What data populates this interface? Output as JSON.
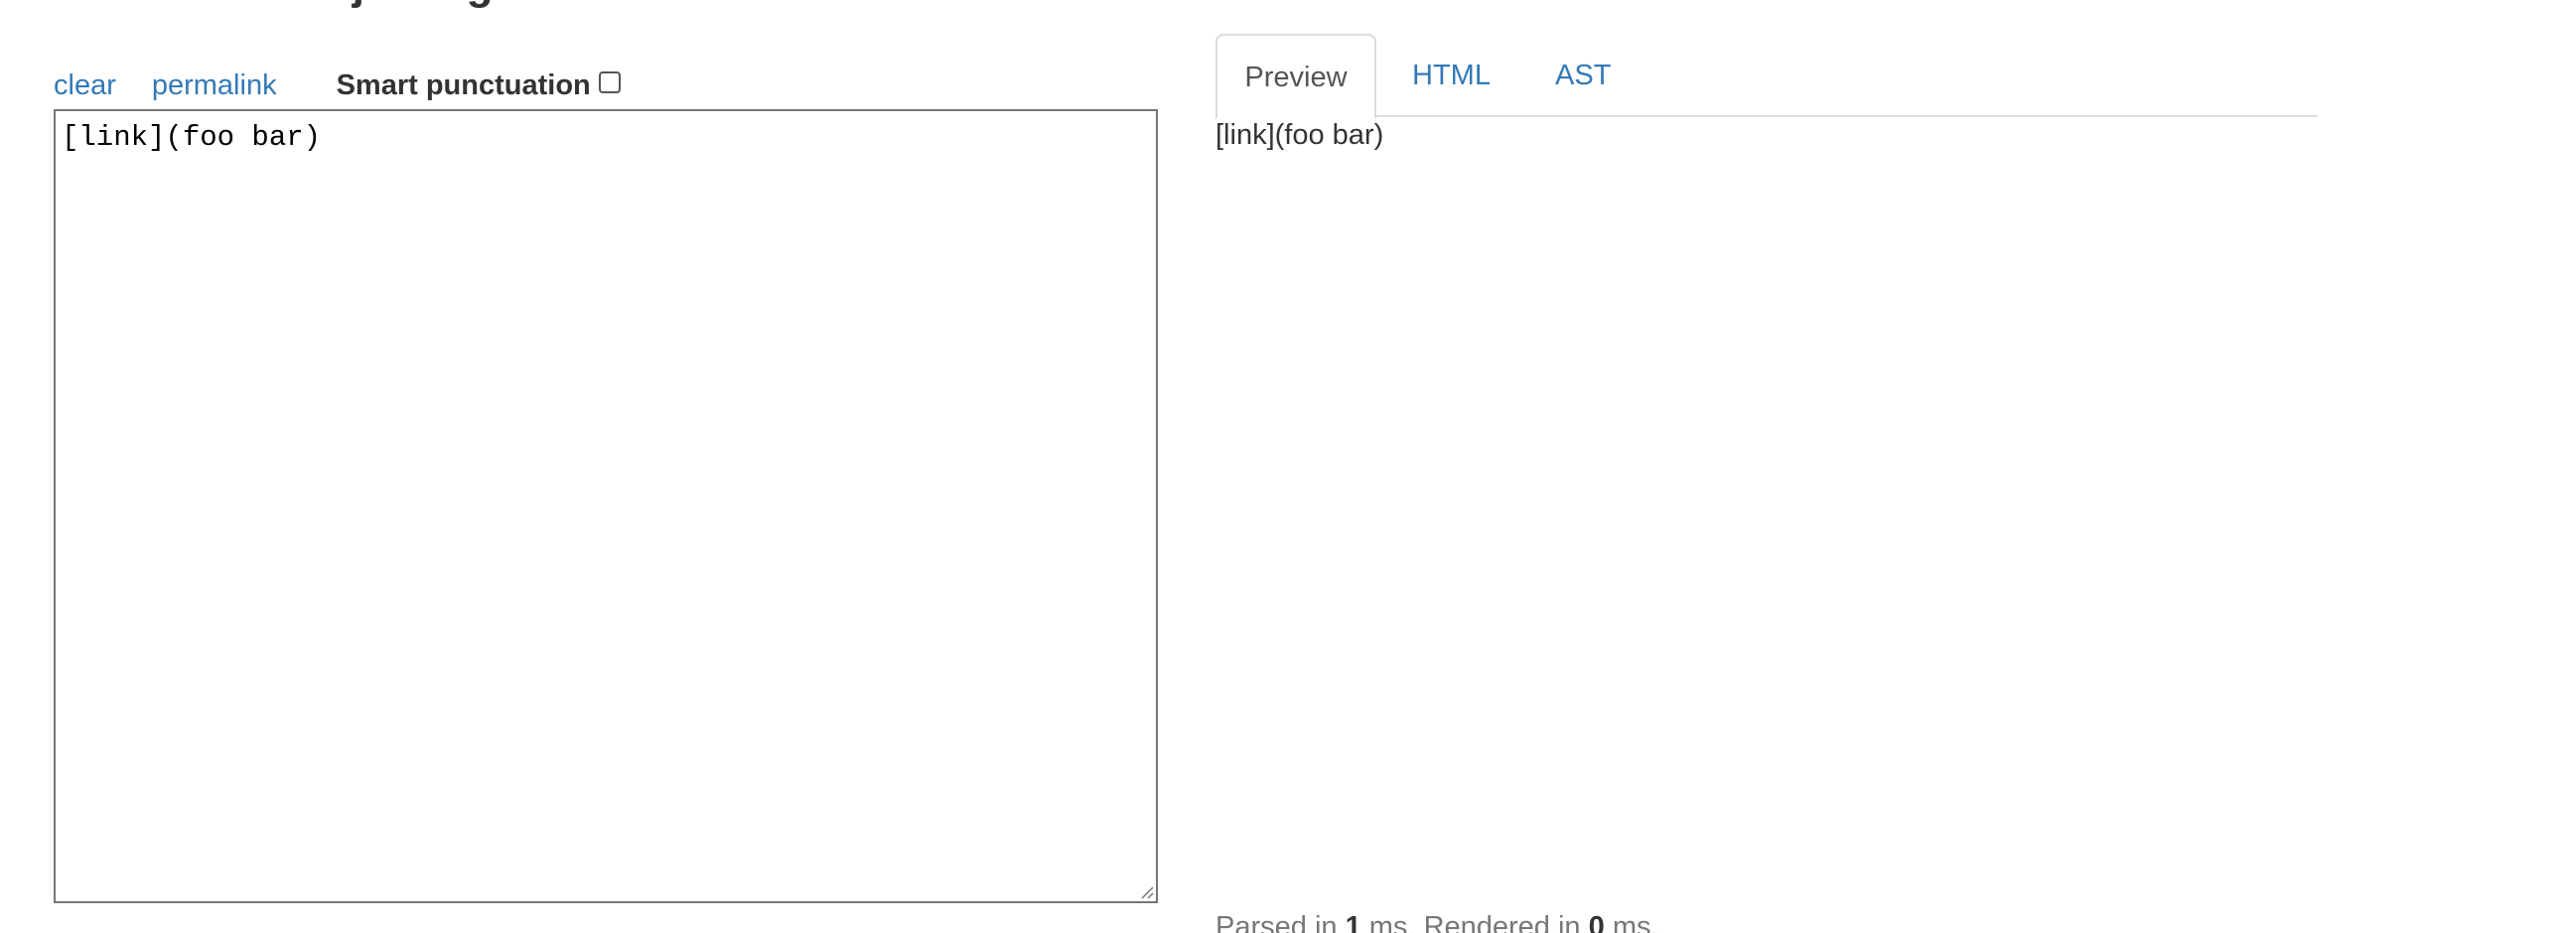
{
  "header": {
    "title": "commonmark.js dingus"
  },
  "toolbar": {
    "clear_label": "clear",
    "permalink_label": "permalink",
    "smart_punctuation_label": "Smart punctuation",
    "smart_punctuation_checked": false
  },
  "editor": {
    "value": "[link](foo bar)"
  },
  "tabs": [
    {
      "label": "Preview",
      "active": true
    },
    {
      "label": "HTML",
      "active": false
    },
    {
      "label": "AST",
      "active": false
    }
  ],
  "preview": {
    "text": "[link](foo bar)"
  },
  "timing": {
    "parsed_prefix": "Parsed in ",
    "parsed_ms": "1",
    "parsed_suffix": " ms. ",
    "rendered_prefix": "Rendered in ",
    "rendered_ms": "0",
    "rendered_suffix": " ms."
  },
  "colors": {
    "link": "#337ab7",
    "text": "#333333",
    "muted": "#777777",
    "border": "#dddddd"
  }
}
